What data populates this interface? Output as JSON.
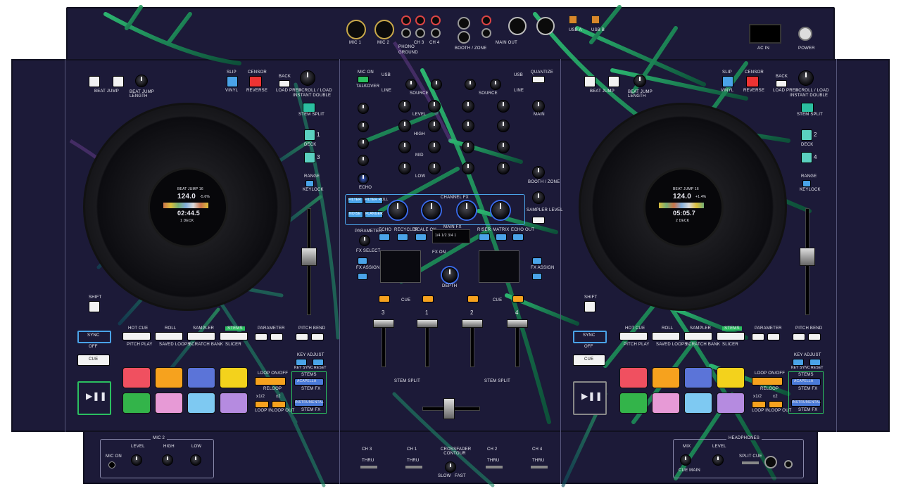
{
  "top_panel": {
    "inputs": [
      "MIC 1",
      "MIC 2",
      "PHONO",
      "GROUND",
      "CH 3",
      "CH 4",
      "BOOTH / ZONE",
      "MAIN OUT",
      "USB A",
      "USB B",
      "AC IN",
      "POWER"
    ]
  },
  "deck_left": {
    "beat_jump_label": "BEAT JUMP",
    "beat_jump_length": "BEAT JUMP LENGTH",
    "slip": "SLIP",
    "vinyl": "VINYL",
    "censor": "CENSOR",
    "reverse": "REVERSE",
    "back": "BACK",
    "load_prep": "LOAD PREP",
    "scroll_load": "SCROLL / LOAD",
    "instant_double": "INSTANT DOUBLE",
    "stem_split": "STEM SPLIT",
    "deck_label": "DECK",
    "deck_nums": [
      "1",
      "3"
    ],
    "range": "RANGE",
    "keylock": "KEYLOCK",
    "shift": "SHIFT",
    "sync": "SYNC",
    "off": "OFF",
    "cue": "CUE",
    "screen": {
      "title": "BEAT JUMP 16",
      "bpm": "124.0",
      "time": "02:44.5",
      "deck": "1 DECK",
      "pitch": "-5.6%"
    },
    "pad_modes": [
      "HOT CUE",
      "ROLL",
      "SAMPLER",
      "STEMS"
    ],
    "pad_modes_shift": [
      "PITCH PLAY",
      "SAVED LOOPS",
      "SCRATCH BANK",
      "SLICER"
    ],
    "parameter": "PARAMETER",
    "pitch_bend": "PITCH BEND",
    "key_adjust": "KEY ADJUST",
    "key_sync": "KEY SYNC",
    "reset": "RESET",
    "loop_onoff": "LOOP ON/OFF",
    "reloop": "RELOOP",
    "half": "x1/2",
    "double": "x2",
    "loop_in": "LOOP IN",
    "loop_out": "LOOP OUT",
    "stems": "STEMS",
    "acapella": "ACAPELLA",
    "stem_fx": "STEM FX",
    "instrumental": "INSTRUMENTAL"
  },
  "deck_right": {
    "screen": {
      "title": "BEAT JUMP 16",
      "bpm": "124.0",
      "time": "05:05.7",
      "deck": "2 DECK",
      "pitch": "+1.4%"
    },
    "deck_nums": [
      "2",
      "4"
    ]
  },
  "mixer": {
    "mic_on": "MIC ON",
    "talkover": "TALKOVER",
    "source": "SOURCE",
    "usb": "USB",
    "line": "LINE",
    "quantize": "QUANTIZE",
    "eq": [
      "LEVEL",
      "HIGH",
      "MID",
      "LOW"
    ],
    "echo": "ECHO",
    "main": "MAIN",
    "booth": "BOOTH / ZONE",
    "filter": "FILTER",
    "filter_roll": "FILTER ROLL",
    "noise": "NOISE",
    "flanger": "FLANGER",
    "channel_fx": "CHANNEL FX",
    "sampler_level": "SAMPLER LEVEL",
    "parameter": "PARAMETER",
    "fx_names": [
      "ECHO",
      "RECYCLER",
      "SCALE ON",
      "RISER",
      "MATRIX",
      "ECHO OUT"
    ],
    "main_fx": "MAIN FX",
    "fx_display": "1/4 1/2 3/4 1",
    "fx_select": "FX SELECT",
    "fx_assign": "FX ASSIGN",
    "fx_on": "FX ON",
    "depth": "DEPTH",
    "ch_fader_nums": [
      "3",
      "1",
      "2",
      "4"
    ],
    "cue": "CUE",
    "stem_split": "STEM SPLIT"
  },
  "bottom": {
    "mic2": "MIC 2",
    "mic_on": "MIC ON",
    "level": "LEVEL",
    "high": "HIGH",
    "low": "LOW",
    "channels": [
      "CH 3",
      "CH 1",
      "CROSSFADER CONTOUR",
      "CH 2",
      "CH 4"
    ],
    "thru": "THRU",
    "slow": "SLOW",
    "fast": "FAST",
    "headphones": "HEADPHONES",
    "mix": "MIX",
    "cue_main": "CUE    MAIN",
    "split_cue": "SPLIT CUE"
  },
  "colors": {
    "body": "#1c1a38",
    "palm_green": "#1fa35a",
    "pad_colors": [
      "#f05060",
      "#f6a21e",
      "#5b74d8",
      "#f3d21c",
      "#33b44a",
      "#e79ad6",
      "#7ec9f2",
      "#b58be0"
    ]
  }
}
